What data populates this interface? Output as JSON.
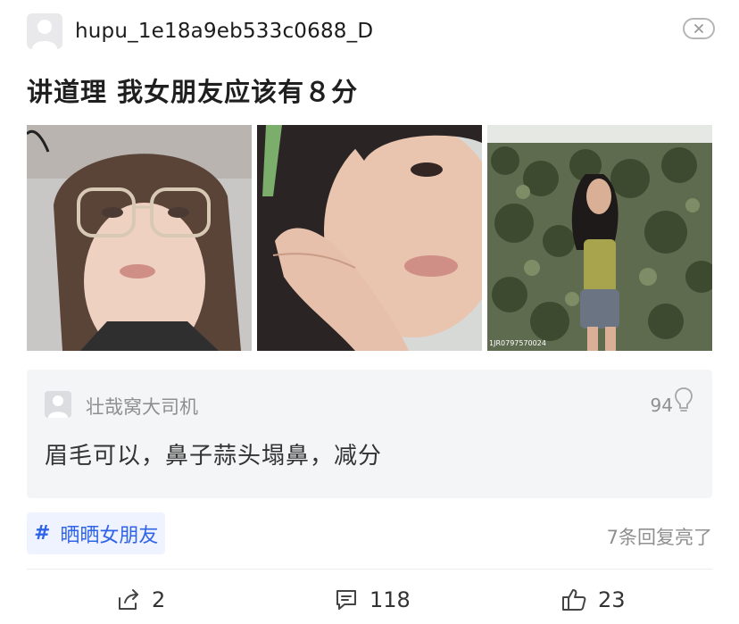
{
  "header": {
    "username": "hupu_1e18a9eb533c0688_D",
    "avatar_icon": "user-avatar-icon",
    "close_icon": "close-icon"
  },
  "post": {
    "title": "讲道理 我女朋友应该有８分",
    "photos": [
      {
        "alt": "photo-1"
      },
      {
        "alt": "photo-2"
      },
      {
        "alt": "photo-3",
        "watermark": "1JR0797570024"
      }
    ]
  },
  "top_comment": {
    "username": "壮哉窝大司机",
    "light_count": "94",
    "text": "眉毛可以，鼻子蒜头塌鼻，减分"
  },
  "topic": {
    "label": "晒晒女朋友"
  },
  "reply_status": "7条回复亮了",
  "actions": {
    "share_count": "2",
    "comment_count": "118",
    "like_count": "23"
  },
  "colors": {
    "accent": "#2f63e8",
    "tag_bg": "#eef3ff",
    "card_bg": "#f4f5f7",
    "muted_text": "#8f8f8f"
  }
}
